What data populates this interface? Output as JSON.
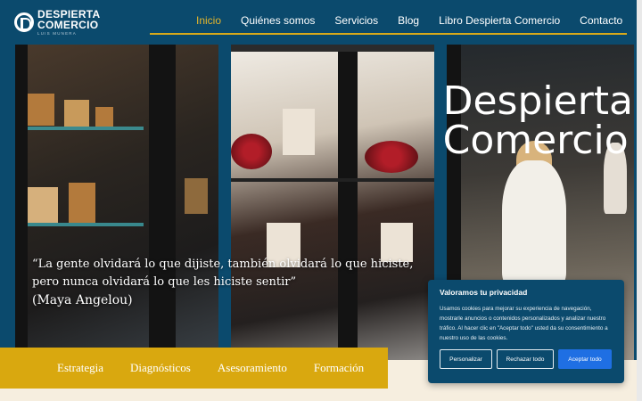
{
  "brand": {
    "line1": "DESPIERTA",
    "line2": "COMERCIO",
    "sub": "LUIS MUNERA"
  },
  "nav": {
    "items": [
      {
        "label": "Inicio",
        "active": true
      },
      {
        "label": "Quiénes somos"
      },
      {
        "label": "Servicios"
      },
      {
        "label": "Blog"
      },
      {
        "label": "Libro Despierta Comercio"
      },
      {
        "label": "Contacto"
      }
    ]
  },
  "hero": {
    "title_line1": "Despierta",
    "title_line2": "Comercio",
    "quote_line1": "“La gente olvidará lo que dijiste, también olvidará lo que hiciste,",
    "quote_line2": "pero nunca olvidará lo que les hiciste sentir”",
    "quote_author": "(Maya Angelou)"
  },
  "services": {
    "items": [
      "Estrategia",
      "Diagnósticos",
      "Asesoramiento",
      "Formación"
    ]
  },
  "cookie": {
    "title": "Valoramos tu privacidad",
    "text": "Usamos cookies para mejorar su experiencia de navegación, mostrarle anuncios o contenidos personalizados y analizar nuestro tráfico. Al hacer clic en \"Aceptar todo\" usted da su consentimiento a nuestro uso de las cookies.",
    "customize": "Personalizar",
    "reject": "Rechazar todo",
    "accept": "Aceptar todo"
  },
  "colors": {
    "primary": "#0b4a6d",
    "accent": "#d9a80f",
    "nav_active": "#e4b52c",
    "button_accept": "#1f6fe3"
  }
}
